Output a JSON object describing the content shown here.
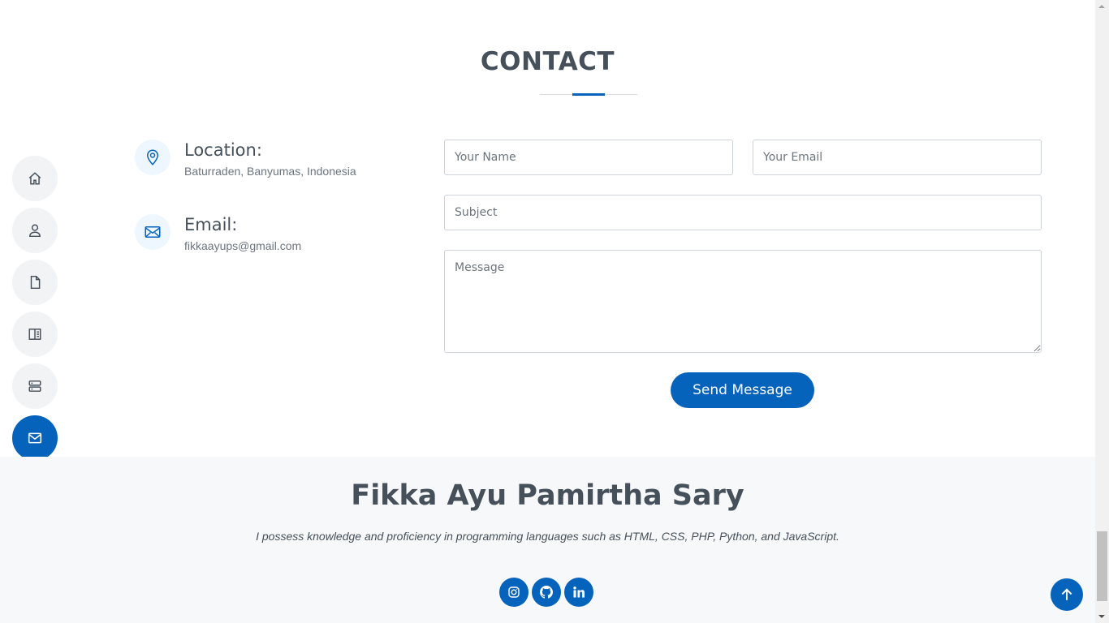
{
  "section": {
    "title": "CONTACT"
  },
  "nav": {
    "items": [
      {
        "icon": "home-icon"
      },
      {
        "icon": "person-icon"
      },
      {
        "icon": "file-icon"
      },
      {
        "icon": "book-icon"
      },
      {
        "icon": "server-icon"
      },
      {
        "icon": "envelope-icon",
        "active": true
      }
    ]
  },
  "info": {
    "location": {
      "label": "Location:",
      "value": "Baturraden, Banyumas, Indonesia"
    },
    "email": {
      "label": "Email:",
      "value": "fikkaayups@gmail.com"
    }
  },
  "form": {
    "name_placeholder": "Your Name",
    "email_placeholder": "Your Email",
    "subject_placeholder": "Subject",
    "message_placeholder": "Message",
    "send_label": "Send Message"
  },
  "footer": {
    "name": "Fikka Ayu Pamirtha Sary",
    "tagline": "I possess knowledge and proficiency in programming languages such as HTML, CSS, PHP, Python, and JavaScript.",
    "social": [
      "instagram-icon",
      "github-icon",
      "linkedin-icon"
    ]
  },
  "colors": {
    "accent": "#0563bb",
    "text": "#45505b",
    "footer_bg": "#f7f8f9"
  }
}
